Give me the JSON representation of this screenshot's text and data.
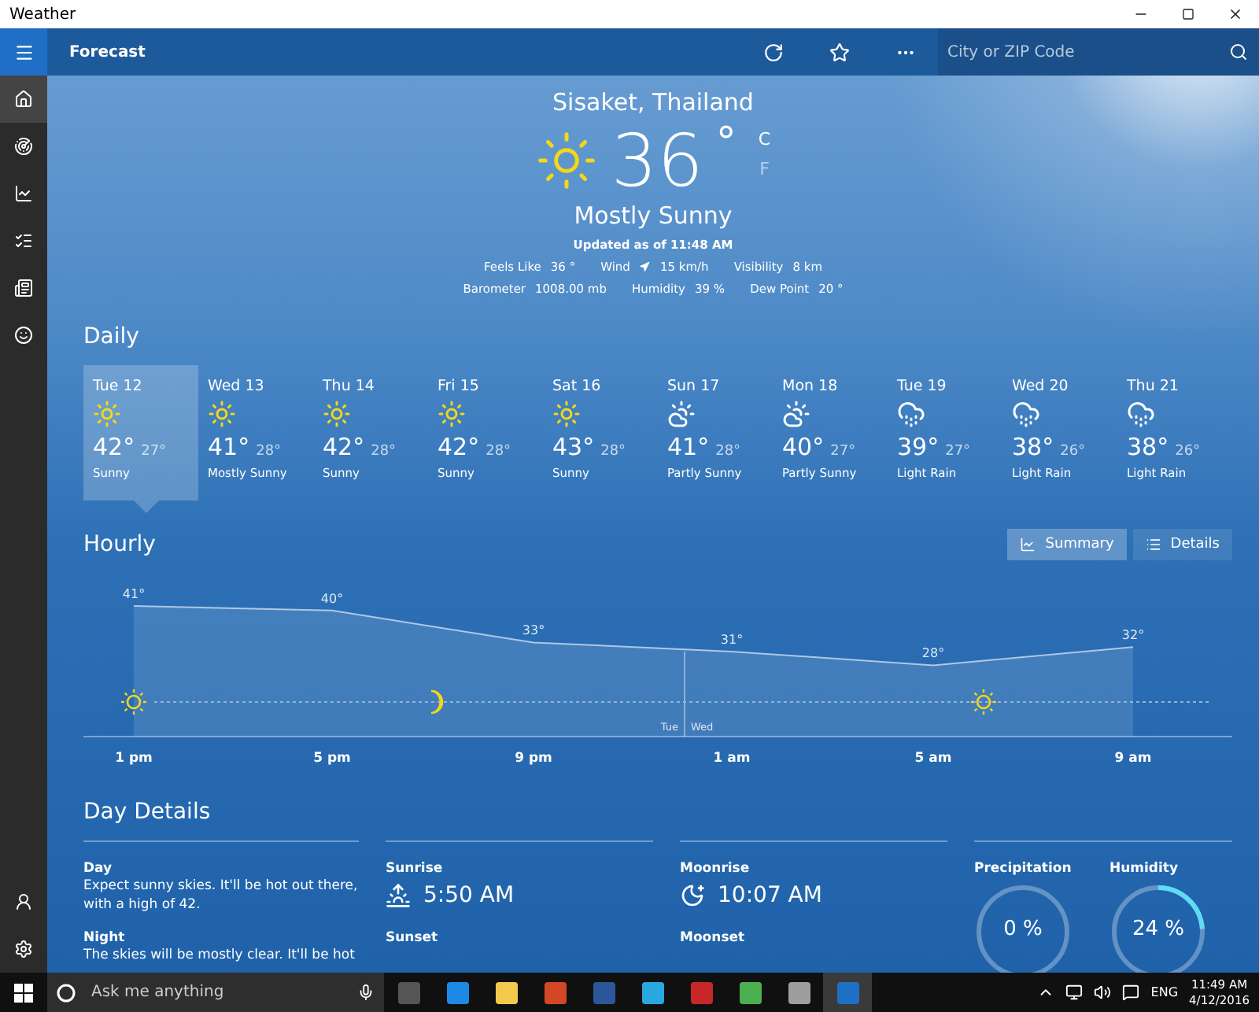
{
  "window": {
    "title": "Weather"
  },
  "app_bar": {
    "title": "Forecast",
    "search": {
      "placeholder": "City or ZIP Code"
    }
  },
  "nav": {
    "items": [
      {
        "kind": "home",
        "selected": true
      },
      {
        "kind": "maps",
        "selected": false
      },
      {
        "kind": "historical",
        "selected": false
      },
      {
        "kind": "places",
        "selected": false
      },
      {
        "kind": "news",
        "selected": false
      },
      {
        "kind": "feedback",
        "selected": false
      }
    ],
    "bottom": [
      {
        "kind": "account",
        "selected": false
      },
      {
        "kind": "settings",
        "selected": false
      }
    ]
  },
  "current": {
    "location": "Sisaket, Thailand",
    "temperature": "36",
    "degree": "°",
    "units": [
      {
        "label": "C",
        "selected": true
      },
      {
        "label": "F",
        "selected": false
      }
    ],
    "condition": "Mostly Sunny",
    "updated": "Updated as of 11:48 AM",
    "details": [
      [
        {
          "label": "Feels Like",
          "value": "36 °"
        },
        {
          "label": "Wind",
          "value": "15 km/h",
          "arrow": true
        },
        {
          "label": "Visibility",
          "value": "8 km"
        }
      ],
      [
        {
          "label": "Barometer",
          "value": "1008.00 mb"
        },
        {
          "label": "Humidity",
          "value": "39 %"
        },
        {
          "label": "Dew Point",
          "value": "20 °"
        }
      ]
    ]
  },
  "daily": {
    "title": "Daily",
    "days": [
      {
        "day": "Tue 12",
        "kind": "sunny",
        "high": "42°",
        "low": "27°",
        "condition": "Sunny",
        "selected": true
      },
      {
        "day": "Wed 13",
        "kind": "sunny",
        "high": "41°",
        "low": "28°",
        "condition": "Mostly Sunny",
        "selected": false
      },
      {
        "day": "Thu 14",
        "kind": "sunny",
        "high": "42°",
        "low": "28°",
        "condition": "Sunny",
        "selected": false
      },
      {
        "day": "Fri 15",
        "kind": "sunny",
        "high": "42°",
        "low": "28°",
        "condition": "Sunny",
        "selected": false
      },
      {
        "day": "Sat 16",
        "kind": "sunny",
        "high": "43°",
        "low": "28°",
        "condition": "Sunny",
        "selected": false
      },
      {
        "day": "Sun 17",
        "kind": "partly-sunny",
        "high": "41°",
        "low": "28°",
        "condition": "Partly Sunny",
        "selected": false
      },
      {
        "day": "Mon 18",
        "kind": "partly-sunny",
        "high": "40°",
        "low": "27°",
        "condition": "Partly Sunny",
        "selected": false
      },
      {
        "day": "Tue 19",
        "kind": "rain",
        "high": "39°",
        "low": "27°",
        "condition": "Light Rain",
        "selected": false
      },
      {
        "day": "Wed 20",
        "kind": "rain",
        "high": "38°",
        "low": "26°",
        "condition": "Light Rain",
        "selected": false
      },
      {
        "day": "Thu 21",
        "kind": "rain",
        "high": "38°",
        "low": "26°",
        "condition": "Light Rain",
        "selected": false
      }
    ]
  },
  "hourly": {
    "title": "Hourly",
    "views": [
      {
        "label": "Summary",
        "kind": "summary",
        "selected": true
      },
      {
        "label": "Details",
        "kind": "details",
        "selected": false
      }
    ],
    "day_split": [
      "Tue",
      "Wed"
    ],
    "chart_data": {
      "type": "area",
      "categories": [
        "1 pm",
        "5 pm",
        "9 pm",
        "1 am",
        "5 am",
        "9 am"
      ],
      "series": [
        {
          "color": "#ffffff",
          "values": [
            41,
            40,
            33,
            31,
            28,
            32
          ],
          "value_labels": [
            "41°",
            "40°",
            "33°",
            "31°",
            "28°",
            "32°"
          ]
        }
      ],
      "data_labels": true
    }
  },
  "day_details": {
    "title": "Day Details",
    "forecast": [
      {
        "label": "Day",
        "text": "Expect sunny skies. It'll be hot out there, with a high of 42."
      },
      {
        "label": "Night",
        "text": "The skies will be mostly clear. It'll be hot"
      }
    ],
    "sun": {
      "label": "Sunrise",
      "value": "5:50 AM",
      "next_label": "Sunset"
    },
    "moon": {
      "label": "Moonrise",
      "value": "10:07 AM",
      "next_label": "Moonset"
    },
    "gauges": [
      {
        "label": "Precipitation",
        "reading": "0 %",
        "level": 0
      },
      {
        "label": "Humidity",
        "reading": "24 %",
        "level": 0.24
      }
    ]
  },
  "taskbar": {
    "search": {
      "placeholder": "Ask me anything"
    },
    "language": "ENG",
    "time": "11:49 AM",
    "date": "4/12/2016"
  }
}
